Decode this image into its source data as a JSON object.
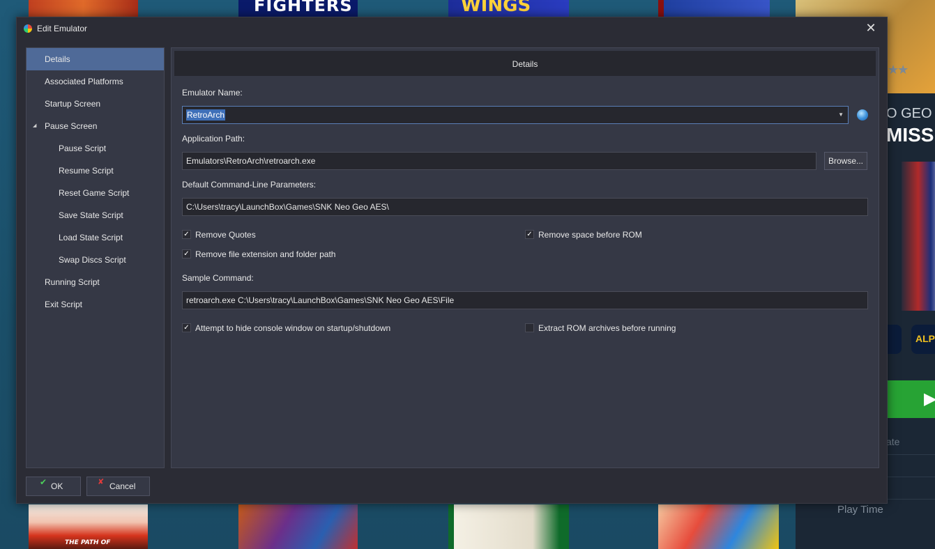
{
  "background": {
    "top_tiles": [
      "",
      "FIGHTERS",
      "WINGS",
      ""
    ],
    "bottom_tile_1_text": "THE PATH OF",
    "sidebar": {
      "title_line1": "O GEO .",
      "title_line2": "MISS",
      "icon_label": "ALP",
      "rate_label": "ate",
      "play_time_label": "Play Time"
    }
  },
  "dialog": {
    "title": "Edit Emulator",
    "nav": [
      {
        "label": "Details"
      },
      {
        "label": "Associated Platforms"
      },
      {
        "label": "Startup Screen"
      },
      {
        "label": "Pause Screen"
      },
      {
        "label": "Pause Script"
      },
      {
        "label": "Resume Script"
      },
      {
        "label": "Reset Game Script"
      },
      {
        "label": "Save State Script"
      },
      {
        "label": "Load State Script"
      },
      {
        "label": "Swap Discs Script"
      },
      {
        "label": "Running Script"
      },
      {
        "label": "Exit Script"
      }
    ],
    "selected_nav": "Details",
    "panel_header": "Details",
    "emulator_name_label": "Emulator Name:",
    "emulator_name_value": "RetroArch",
    "application_path_label": "Application Path:",
    "application_path_value": "Emulators\\RetroArch\\retroarch.exe",
    "browse_label": "Browse...",
    "cmdline_label": "Default Command-Line Parameters:",
    "cmdline_value": "C:\\Users\\tracy\\LaunchBox\\Games\\SNK Neo Geo AES\\",
    "remove_quotes_label": "Remove Quotes",
    "remove_quotes_checked": true,
    "remove_space_label": "Remove space before ROM",
    "remove_space_checked": true,
    "remove_ext_label": "Remove file extension and folder path",
    "remove_ext_checked": true,
    "sample_command_label": "Sample Command:",
    "sample_command_value": "retroarch.exe C:\\Users\\tracy\\LaunchBox\\Games\\SNK Neo Geo AES\\File",
    "hide_console_label": "Attempt to hide console window on startup/shutdown",
    "hide_console_checked": true,
    "extract_rom_label": "Extract ROM archives before running",
    "extract_rom_checked": false,
    "ok_label": "OK",
    "cancel_label": "Cancel"
  },
  "colors": {
    "dialog_bg": "#2b2c35",
    "panel_bg": "#353845",
    "selected_nav": "#4f6a98",
    "field_bg": "#26272e",
    "selection": "#3e6fb8",
    "ok_icon": "#4cd05a",
    "cancel_icon": "#e23b3b"
  }
}
